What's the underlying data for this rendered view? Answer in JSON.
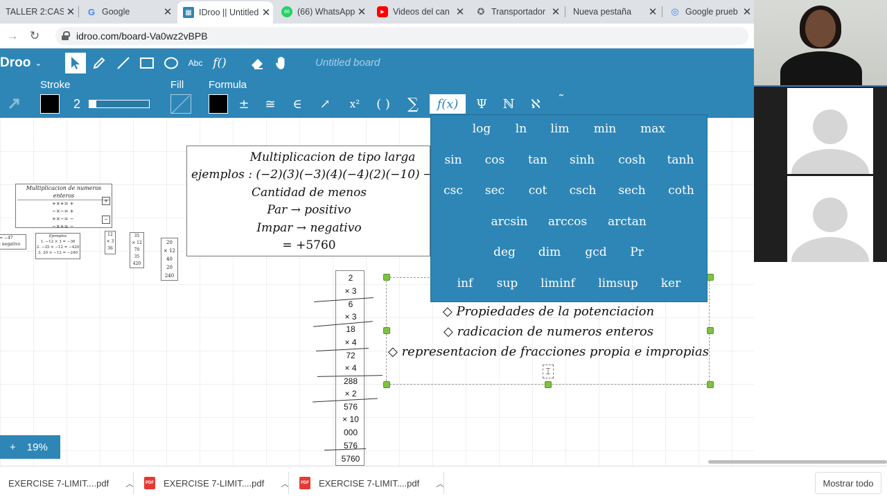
{
  "browser": {
    "tabs": [
      {
        "title": "TALLER 2:CASO",
        "icon": "doc-icon"
      },
      {
        "title": "Google",
        "icon": "google-icon"
      },
      {
        "title": "IDroo || Untitled",
        "icon": "idroo-icon"
      },
      {
        "title": "(66) WhatsApp",
        "icon": "whatsapp-icon"
      },
      {
        "title": "Videos del can",
        "icon": "youtube-icon"
      },
      {
        "title": "Transportador",
        "icon": "transportador-icon"
      },
      {
        "title": "Nueva pestaña",
        "icon": ""
      },
      {
        "title": "Google prueb",
        "icon": "google-icon"
      }
    ],
    "url": "idroo.com/board-Va0wz2vBPB"
  },
  "toolbar": {
    "brand": "Droo",
    "board_title": "Untitled board",
    "text_tool_label": "Abc",
    "formula_tool_label": "f()",
    "stroke_label": "Stroke",
    "fill_label": "Fill",
    "formula_label": "Formula",
    "stroke_width": "2",
    "stroke_slider_fraction": 0.12,
    "stroke_color": "#000000",
    "formula_color": "#000000",
    "accent_color": "#2e86b7",
    "formula_symbols": [
      "±",
      "≅",
      "∈",
      "↗",
      "x²",
      "( )",
      "∑",
      "f(x)",
      "Ψ",
      "ℕ",
      "ℵ",
      "˜"
    ]
  },
  "board": {
    "main_box": {
      "lines": [
        "Multiplicacion de tipo larga",
        "ejemplos : (−2)(3)(−3)(4)(−4)(2)(−10) →",
        "Cantidad de menos",
        "Par → positivo",
        "Impar → negativo",
        "= +5760"
      ]
    },
    "mini_title_box": {
      "title": "Multiplicacion de numeros enteros",
      "rows": [
        "+×+= +",
        "−×−= +",
        "+×−= −",
        "−×+= −"
      ],
      "badges": [
        "+",
        "−"
      ]
    },
    "mini_left_box": [
      "= −47",
      ": negativo"
    ],
    "mini_examples_box": {
      "title": "Ejemplos",
      "rows": [
        "1. −12 × 3 = −36",
        "2. −35 × −12 = −420",
        "3. 20 × −12 = −240"
      ]
    },
    "mini_col_1": [
      "12",
      "× 3",
      "36"
    ],
    "mini_col_2": [
      "35",
      "× 12",
      "70",
      "35",
      "420"
    ],
    "mini_col_3": [
      "20",
      "× 12",
      "40",
      "20",
      "240"
    ],
    "long_column": [
      "2",
      "× 3",
      "6",
      "× 3",
      "18",
      "× 4",
      "72",
      "× 4",
      "288",
      "× 2",
      "576",
      "× 10",
      "000",
      "576",
      "5760"
    ],
    "list_items": [
      "◇ Propiedades de la potenciacion",
      "◇ radicacion de numeros enteros",
      "◇ representacion de fracciones propia e impropias"
    ],
    "zoom_plus": "+",
    "zoom_level": "19%"
  },
  "function_menu": {
    "rows": [
      [
        "log",
        "ln",
        "lim",
        "min",
        "max"
      ],
      [
        "sin",
        "cos",
        "tan",
        "sinh",
        "cosh",
        "tanh"
      ],
      [
        "csc",
        "sec",
        "cot",
        "csch",
        "sech",
        "coth"
      ],
      [
        "arcsin",
        "arccos",
        "arctan"
      ],
      [
        "deg",
        "dim",
        "gcd",
        "Pr"
      ],
      [
        "inf",
        "sup",
        "liminf",
        "limsup",
        "ker"
      ]
    ]
  },
  "downloads": {
    "items": [
      {
        "name": "EXERCISE 7-LIMIT....pdf"
      },
      {
        "name": "EXERCISE 7-LIMIT....pdf"
      },
      {
        "name": "EXERCISE 7-LIMIT....pdf"
      }
    ],
    "show_all": "Mostrar todo"
  }
}
